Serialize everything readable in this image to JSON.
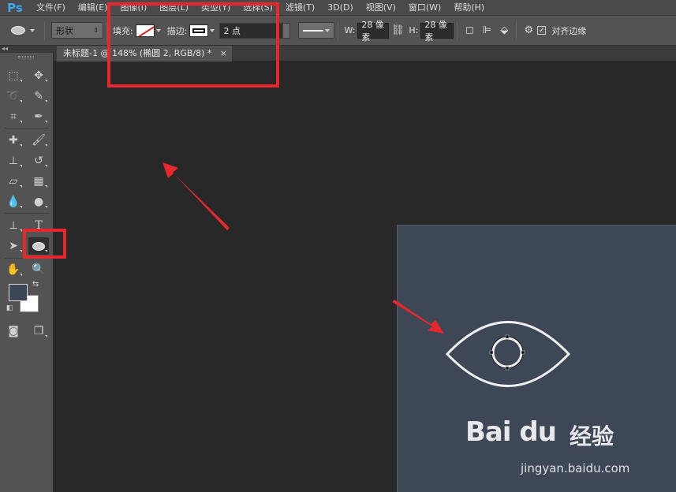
{
  "app": {
    "logo": "Ps"
  },
  "menu": [
    "文件(F)",
    "编辑(E)",
    "图像(I)",
    "图层(L)",
    "类型(Y)",
    "选择(S)",
    "滤镜(T)",
    "3D(D)",
    "视图(V)",
    "窗口(W)",
    "帮助(H)"
  ],
  "options": {
    "mode": "形状",
    "fill_label": "填充:",
    "stroke_label": "描边:",
    "stroke_width": "2 点",
    "w_label": "W:",
    "w_value": "28 像素",
    "h_label": "H:",
    "h_value": "28 像素",
    "align_edges_label": "对齐边缘",
    "align_edges_checked": true
  },
  "tab": {
    "title": "未标题-1 @ 148% (椭圆 2, RGB/8) *",
    "close": "×"
  },
  "colors": {
    "foreground": "#3c4656",
    "background": "#ffffff",
    "highlight": "#e8272d",
    "doc_canvas": "#3d4756"
  },
  "watermark": {
    "logo": "Bai du",
    "cn": "经验",
    "sub": "jingyan.baidu.com"
  }
}
